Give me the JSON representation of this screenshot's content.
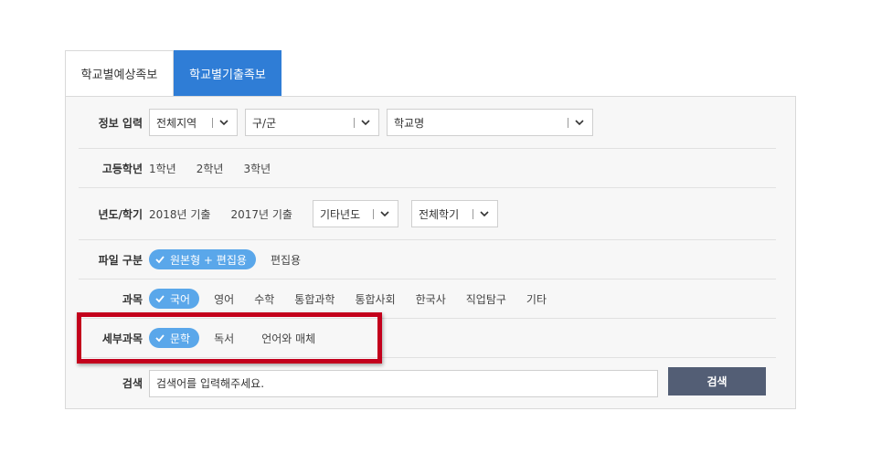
{
  "tabs": [
    {
      "label": "학교별예상족보",
      "active": false
    },
    {
      "label": "학교별기출족보",
      "active": true
    }
  ],
  "info_row": {
    "label": "정보 입력",
    "region_select": "전체지역",
    "district_select": "구/군",
    "school_select": "학교명"
  },
  "grade_row": {
    "label": "고등학년",
    "options": [
      "1학년",
      "2학년",
      "3학년"
    ]
  },
  "year_row": {
    "label": "년도/학기",
    "options": [
      "2018년 기출",
      "2017년 기출"
    ],
    "other_year_select": "기타년도",
    "semester_select": "전체학기"
  },
  "file_row": {
    "label": "파일 구분",
    "selected": "원본형 + 편집용",
    "options": [
      "편집용"
    ]
  },
  "subject_row": {
    "label": "과목",
    "selected": "국어",
    "options": [
      "영어",
      "수학",
      "통합과학",
      "통합사회",
      "한국사",
      "직업탐구",
      "기타"
    ]
  },
  "detail_row": {
    "label": "세부과목",
    "selected": "문학",
    "options": [
      "독서",
      "언어와 매체"
    ]
  },
  "search_row": {
    "label": "검색",
    "placeholder": "검색어를 입력해주세요.",
    "button": "검색"
  },
  "colors": {
    "active_tab": "#2f7dd6",
    "pill": "#5aa7ea",
    "search_button": "#535e75",
    "highlight": "#c3001c"
  }
}
